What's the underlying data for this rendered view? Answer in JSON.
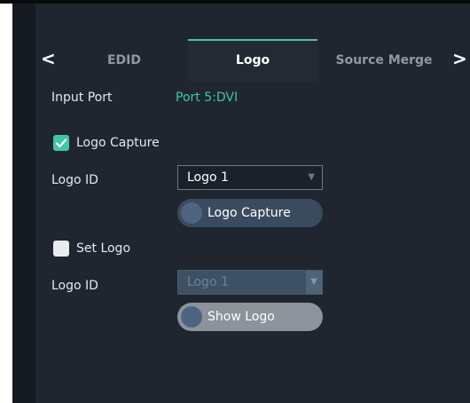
{
  "tabs": {
    "prev_arrow": "<",
    "next_arrow": ">",
    "items": [
      {
        "label": "EDID",
        "active": false
      },
      {
        "label": "Logo",
        "active": true
      },
      {
        "label": "Source Merge",
        "active": false
      }
    ]
  },
  "input_port": {
    "label": "Input Port",
    "value": "Port 5:DVI"
  },
  "logo_capture": {
    "checkbox_label": "Logo Capture",
    "checked": true,
    "logo_id_label": "Logo ID",
    "logo_id_value": "Logo 1",
    "button_label": "Logo Capture"
  },
  "set_logo": {
    "checkbox_label": "Set Logo",
    "checked": false,
    "logo_id_label": "Logo ID",
    "logo_id_value": "Logo 1",
    "button_label": "Show Logo"
  },
  "colors": {
    "accent": "#3fc6a8",
    "panel": "#1f262f"
  }
}
